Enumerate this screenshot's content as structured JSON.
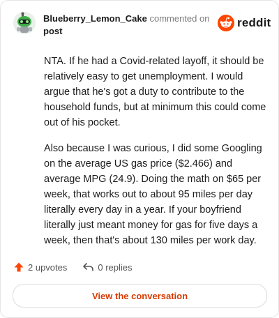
{
  "header": {
    "username": "Blueberry_Lemon_Cake",
    "action": "commented on",
    "post_link": "post",
    "brand": "reddit"
  },
  "comment": {
    "paragraphs": [
      "NTA. If he had a Covid-related layoff, it should be relatively easy to get unemployment. I would argue that he's got a duty to contribute to the household funds, but at minimum this could come out of his pocket.",
      "Also because I was curious, I did some Googling on the average US gas price ($2.466) and average MPG (24.9). Doing the math on $65 per week, that works out to about 95 miles per day literally every day in a year. If your boyfriend literally just meant money for gas for five days a week, then that's about 130 miles per work day."
    ]
  },
  "meta": {
    "upvotes": "2 upvotes",
    "replies": "0 replies"
  },
  "cta": {
    "label": "View the conversation"
  },
  "colors": {
    "accent": "#d93a00",
    "reddit_orange": "#ff4500"
  },
  "icons": {
    "upvote": "upvote-arrow-icon",
    "reply": "reply-arrow-icon",
    "brand": "reddit-snoo-icon"
  }
}
